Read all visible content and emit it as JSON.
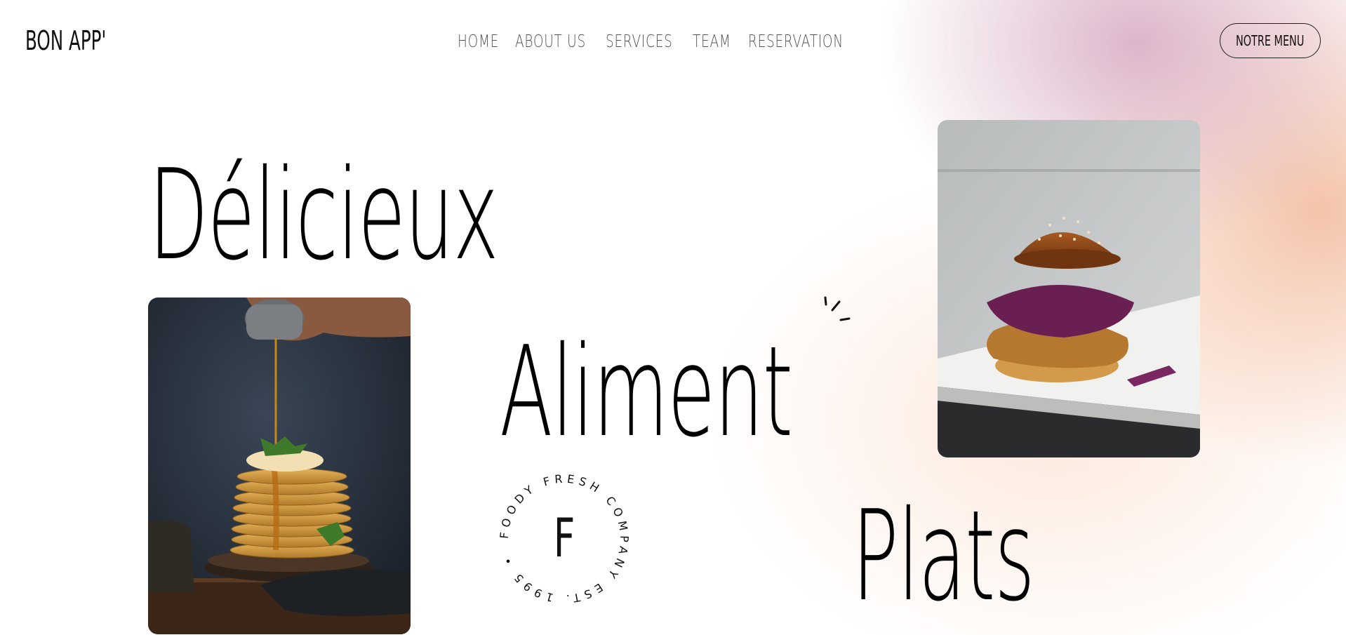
{
  "brand": {
    "logo": "BON APP'"
  },
  "nav": {
    "items": [
      {
        "label": "HOME"
      },
      {
        "label": "ABOUT US"
      },
      {
        "label": "SERVICES"
      },
      {
        "label": "TEAM"
      },
      {
        "label": "RESERVATION"
      }
    ]
  },
  "header": {
    "cta_label": "NOTRE MENU"
  },
  "hero": {
    "word1": "Délicieux",
    "word2": "Aliment",
    "word3": "Plats"
  },
  "badge": {
    "letter": "F",
    "ring_text": "FOODY FRESH COMPANY EST. 1995 •"
  },
  "images": {
    "left": "pancakes-photo",
    "right": "burger-photo"
  },
  "colors": {
    "glow_pink": "#d6aac3",
    "glow_peach": "#f0af8c",
    "text": "#111111",
    "nav_text": "#555555"
  }
}
